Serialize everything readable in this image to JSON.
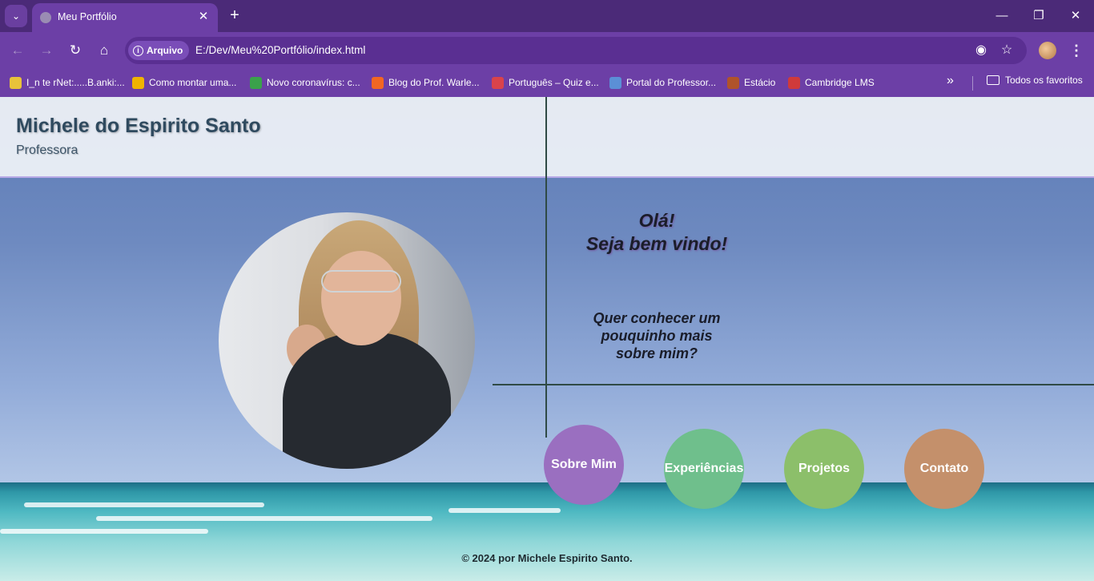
{
  "browser": {
    "tab_title": "Meu Portfólio",
    "url_chip": "Arquivo",
    "url": "E:/Dev/Meu%20Portfólio/index.html",
    "bookmarks": [
      {
        "label": "I_n te rNet:.....B.anki:...",
        "color": "#e8c23a"
      },
      {
        "label": "Como montar uma...",
        "color": "#f0b400"
      },
      {
        "label": "Novo coronavírus: c...",
        "color": "#3aa24b"
      },
      {
        "label": "Blog do Prof. Warle...",
        "color": "#f26722"
      },
      {
        "label": "Português – Quiz e...",
        "color": "#d9434b"
      },
      {
        "label": "Portal do Professor...",
        "color": "#5b8fd6"
      },
      {
        "label": "Estácio",
        "color": "#b0532a"
      },
      {
        "label": "Cambridge LMS",
        "color": "#d03a3a"
      }
    ],
    "all_bookmarks": "Todos os favoritos"
  },
  "header": {
    "name": "Michele do Espirito Santo",
    "role": "Professora"
  },
  "hero": {
    "greeting_line1": "Olá!",
    "greeting_line2": "Seja bem vindo!",
    "question_line1": "Quer conhecer um",
    "question_line2": "pouquinho mais",
    "question_line3": "sobre mim?"
  },
  "nav": [
    {
      "label": "Sobre Mim",
      "color": "#9a6fc0"
    },
    {
      "label": "Experiências",
      "color": "#6fbf8c"
    },
    {
      "label": "Projetos",
      "color": "#8cbf6a"
    },
    {
      "label": "Contato",
      "color": "#c4906b"
    }
  ],
  "footer": "© 2024 por Michele Espirito Santo."
}
